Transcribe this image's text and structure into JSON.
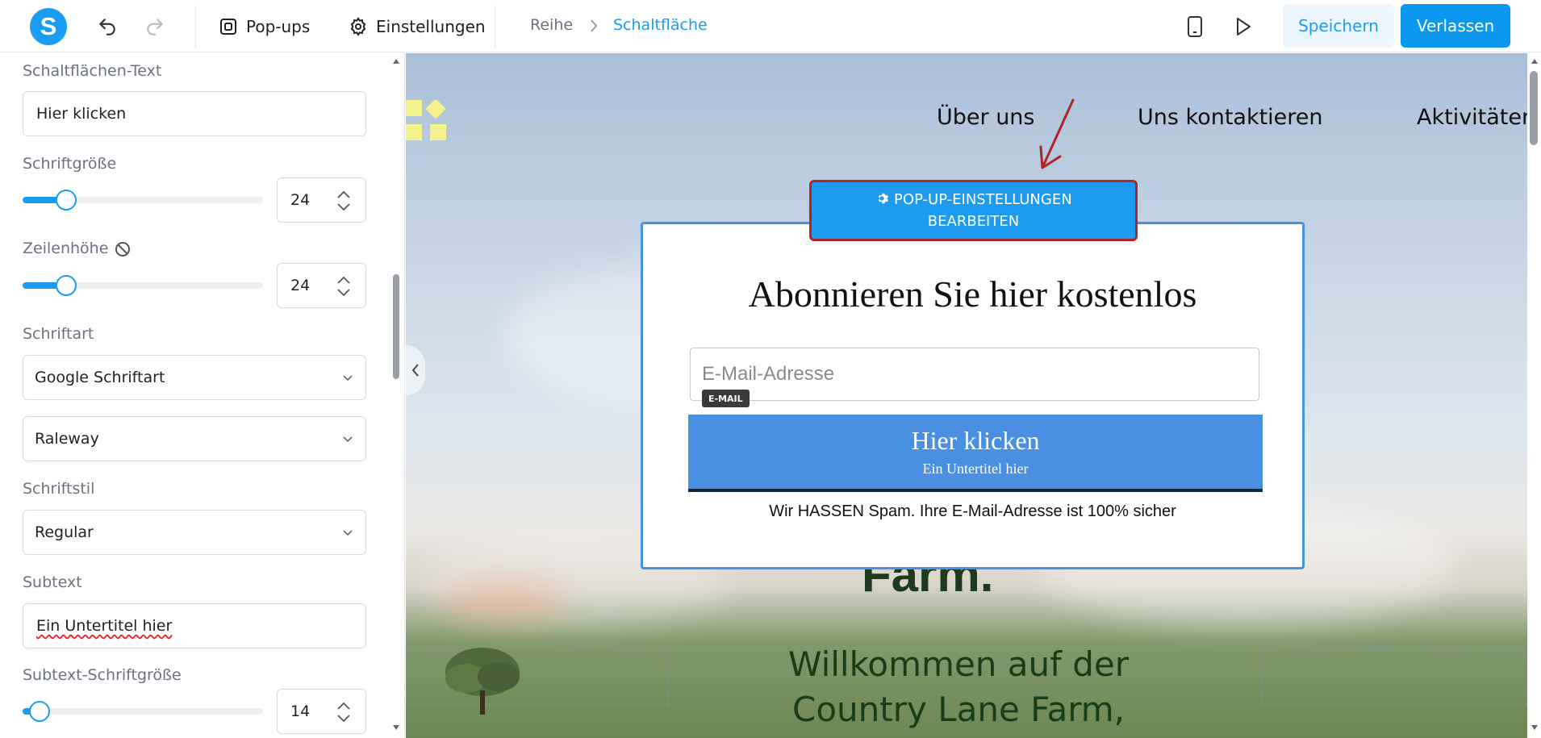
{
  "topbar": {
    "logo_letter": "S",
    "popups_label": "Pop-ups",
    "settings_label": "Einstellungen",
    "breadcrumb": [
      "Reihe",
      "Schaltfläche"
    ],
    "save_label": "Speichern",
    "exit_label": "Verlassen"
  },
  "panel": {
    "button_text_label": "Schaltflächen-Text",
    "button_text_value": "Hier klicken",
    "font_size_label": "Schriftgröße",
    "font_size_value": "24",
    "font_size_level": 0.18,
    "line_height_label": "Zeilenhöhe",
    "line_height_value": "24",
    "line_height_level": 0.18,
    "font_label": "Schriftart",
    "font_source_value": "Google Schriftart",
    "font_family_value": "Raleway",
    "font_style_label": "Schriftstil",
    "font_style_value": "Regular",
    "subtext_label": "Subtext",
    "subtext_value": "Ein Untertitel hier",
    "subtext_size_label": "Subtext-Schriftgröße",
    "subtext_size_value": "14",
    "subtext_size_level": 0.07
  },
  "canvas": {
    "nav": [
      "Über uns",
      "Uns kontaktieren",
      "Aktivitäten"
    ],
    "hero_behind": "Farm.",
    "hero_lines": "Willkommen auf der Country Lane Farm,",
    "edit_button": [
      "POP-UP-EINSTELLUNGEN",
      "BEARBEITEN"
    ]
  },
  "popup": {
    "title": "Abonnieren Sie hier kostenlos",
    "email_placeholder": "E-Mail-Adresse",
    "email_tag": "E-MAIL",
    "cta_text": "Hier klicken",
    "cta_subtext": "Ein Untertitel hier",
    "note": "Wir HASSEN Spam. Ihre E-Mail-Adresse ist 100% sicher"
  },
  "colors": {
    "accent": "#1a9df2",
    "cta": "#4a8fe1",
    "highlight_border": "#b0242a"
  }
}
